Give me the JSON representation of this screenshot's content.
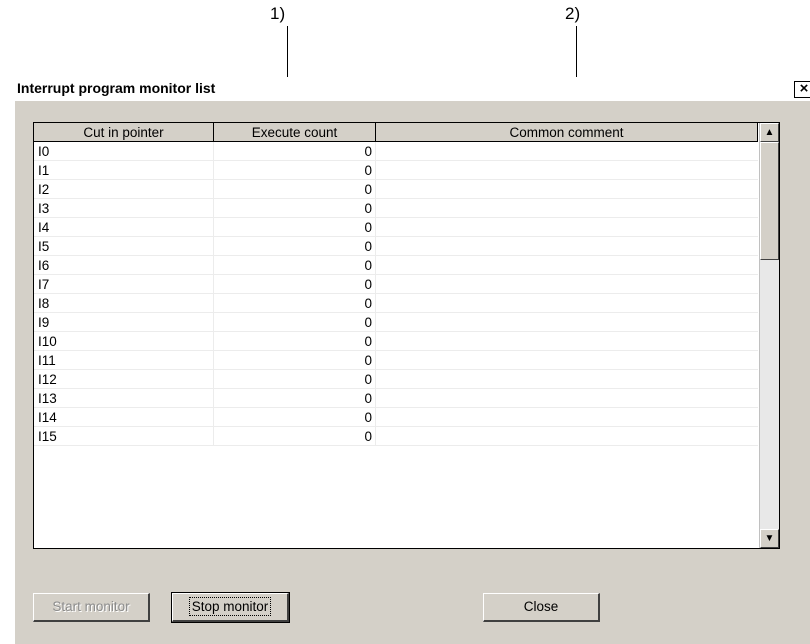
{
  "annotations": [
    {
      "label": "1)"
    },
    {
      "label": "2)"
    }
  ],
  "dialog": {
    "title": "Interrupt program monitor list",
    "close_glyph": "×"
  },
  "table": {
    "columns": [
      "Cut in pointer",
      "Execute count",
      "Common comment"
    ],
    "rows": [
      {
        "pointer": "I0",
        "count": "0",
        "comment": ""
      },
      {
        "pointer": "I1",
        "count": "0",
        "comment": ""
      },
      {
        "pointer": "I2",
        "count": "0",
        "comment": ""
      },
      {
        "pointer": "I3",
        "count": "0",
        "comment": ""
      },
      {
        "pointer": "I4",
        "count": "0",
        "comment": ""
      },
      {
        "pointer": "I5",
        "count": "0",
        "comment": ""
      },
      {
        "pointer": "I6",
        "count": "0",
        "comment": ""
      },
      {
        "pointer": "I7",
        "count": "0",
        "comment": ""
      },
      {
        "pointer": "I8",
        "count": "0",
        "comment": ""
      },
      {
        "pointer": "I9",
        "count": "0",
        "comment": ""
      },
      {
        "pointer": "I10",
        "count": "0",
        "comment": ""
      },
      {
        "pointer": "I11",
        "count": "0",
        "comment": ""
      },
      {
        "pointer": "I12",
        "count": "0",
        "comment": ""
      },
      {
        "pointer": "I13",
        "count": "0",
        "comment": ""
      },
      {
        "pointer": "I14",
        "count": "0",
        "comment": ""
      },
      {
        "pointer": "I15",
        "count": "0",
        "comment": ""
      }
    ]
  },
  "scrollbar": {
    "up_glyph": "▲",
    "down_glyph": "▼"
  },
  "buttons": {
    "start_monitor": "Start monitor",
    "stop_monitor": "Stop monitor",
    "close": "Close"
  }
}
